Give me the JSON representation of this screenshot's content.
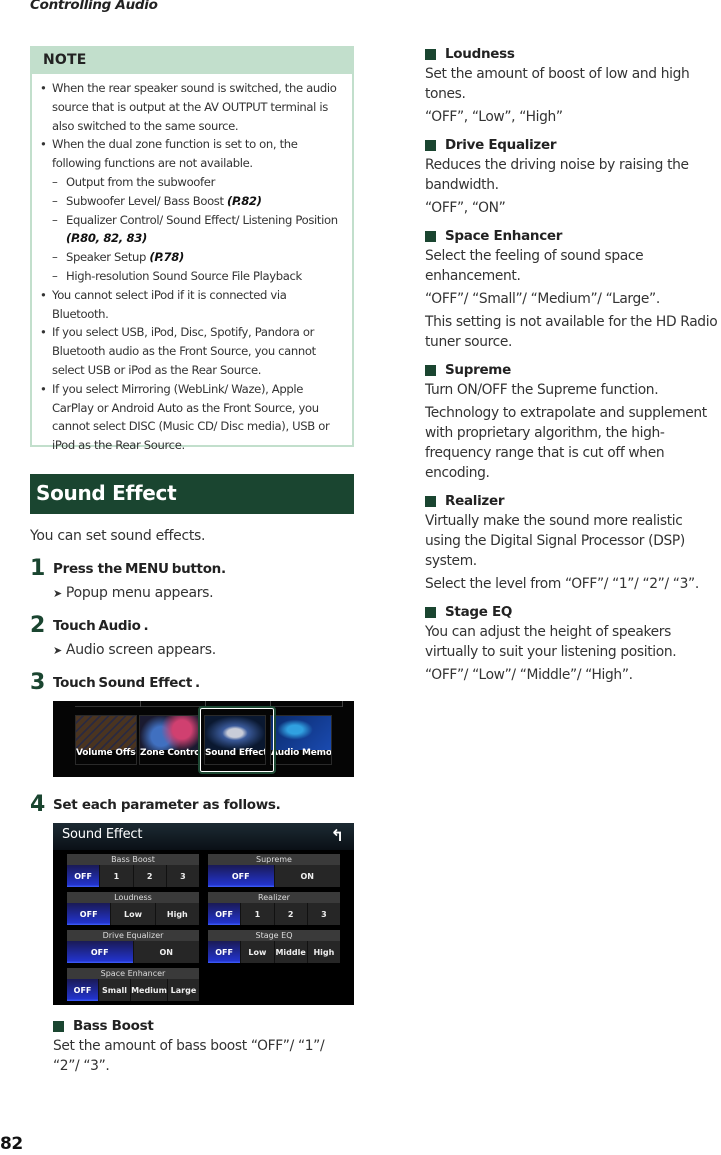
{
  "running_head": "Controlling Audio",
  "page_number": "82",
  "note": {
    "title": "NOTE",
    "items": [
      {
        "text": "When the rear speaker sound is switched, the audio source that is output at the AV OUTPUT terminal is also switched to the same source."
      },
      {
        "text": "When the dual zone function is set to on, the following functions are not available.",
        "subitems": [
          {
            "text": "Output from the subwoofer",
            "ref": ""
          },
          {
            "text": "Subwoofer Level/ Bass Boost ",
            "ref": "(P.82)"
          },
          {
            "text": "Equalizer Control/ Sound Effect/ Listening Position ",
            "ref": "(P.80, 82, 83)"
          },
          {
            "text": "Speaker Setup ",
            "ref": "(P.78)"
          },
          {
            "text": "High-resolution Sound Source File Playback",
            "ref": ""
          }
        ]
      },
      {
        "text": "You cannot select iPod if it is connected via Bluetooth."
      },
      {
        "text": "If you select USB, iPod, Disc, Spotify, Pandora or Bluetooth audio as the Front Source, you cannot select USB or iPod as the Rear Source."
      },
      {
        "text": "If you select Mirroring (WebLink/ Waze), Apple CarPlay or Android Auto as the Front Source, you cannot select DISC (Music CD/ Disc media), USB or iPod as the Rear Source."
      }
    ],
    "bullet": "•",
    "dash": "–"
  },
  "section": {
    "title": "Sound Effect",
    "intro": "You can set sound effects."
  },
  "steps": [
    {
      "num": "1",
      "pre": "Press the",
      "keyword": "MENU",
      "post": "button.",
      "result": "Popup menu appears."
    },
    {
      "num": "2",
      "pre": "Touch",
      "keyword": "Audio",
      "post": ".",
      "result": "Audio screen appears."
    },
    {
      "num": "3",
      "pre": "Touch",
      "keyword": "Sound Effect",
      "post": ".",
      "result": ""
    },
    {
      "num": "4",
      "pre": "Set each parameter as follows.",
      "keyword": "",
      "post": "",
      "result": ""
    }
  ],
  "result_arrow": "➤",
  "audio_menu": {
    "tiles": [
      "Volume Offset",
      "Zone Contro",
      "Sound Effect",
      "Audio Memory"
    ],
    "highlighted": "Sound Effect"
  },
  "sound_effect_screen": {
    "title": "Sound Effect",
    "back_icon": "↰",
    "groups": [
      {
        "name": "Bass Boost",
        "options": [
          "OFF",
          "1",
          "2",
          "3"
        ],
        "selected": "OFF"
      },
      {
        "name": "Supreme",
        "options": [
          "OFF",
          "ON"
        ],
        "selected": "OFF"
      },
      {
        "name": "Loudness",
        "options": [
          "OFF",
          "Low",
          "High"
        ],
        "selected": "OFF"
      },
      {
        "name": "Realizer",
        "options": [
          "OFF",
          "1",
          "2",
          "3"
        ],
        "selected": "OFF"
      },
      {
        "name": "Drive Equalizer",
        "options": [
          "OFF",
          "ON"
        ],
        "selected": "OFF"
      },
      {
        "name": "Stage EQ",
        "options": [
          "OFF",
          "Low",
          "Middle",
          "High"
        ],
        "selected": "OFF"
      },
      {
        "name": "Space Enhancer",
        "options": [
          "OFF",
          "Small",
          "Medium",
          "Large"
        ],
        "selected": "OFF"
      }
    ]
  },
  "params": {
    "bass_boost": {
      "title": "Bass Boost",
      "lines": [
        "Set the amount of bass boost “OFF”/ “1”/ “2”/ “3”."
      ]
    },
    "loudness": {
      "title": "Loudness",
      "lines": [
        "Set the amount of boost of low and high tones.",
        "“OFF”, “Low”, “High”"
      ]
    },
    "drive_eq": {
      "title": "Drive Equalizer",
      "lines": [
        "Reduces the driving noise by raising the bandwidth.",
        "“OFF”, “ON”"
      ]
    },
    "space_enhancer": {
      "title": "Space Enhancer",
      "lines": [
        "Select the feeling of sound space enhancement.",
        "“OFF”/ “Small”/ “Medium”/ “Large”.",
        "This setting is not available for the HD Radio tuner source."
      ]
    },
    "supreme": {
      "title": "Supreme",
      "lines": [
        "Turn ON/OFF the Supreme function.",
        "Technology to extrapolate and supplement with proprietary algorithm, the high-frequency range that is cut off when encoding."
      ]
    },
    "realizer": {
      "title": "Realizer",
      "lines": [
        "Virtually make the sound more realistic using the Digital Signal Processor (DSP) system.",
        "Select the level from “OFF”/ “1”/ “2”/ “3”."
      ]
    },
    "stage_eq": {
      "title": "Stage EQ",
      "lines": [
        "You can adjust the height of speakers virtually to suit your listening position.",
        "“OFF”/ “Low”/ “Middle”/ “High”."
      ]
    }
  },
  "colors": {
    "brand_green": "#1a4530",
    "note_green": "#c2dfcc",
    "active_blue": "#2233cc"
  }
}
